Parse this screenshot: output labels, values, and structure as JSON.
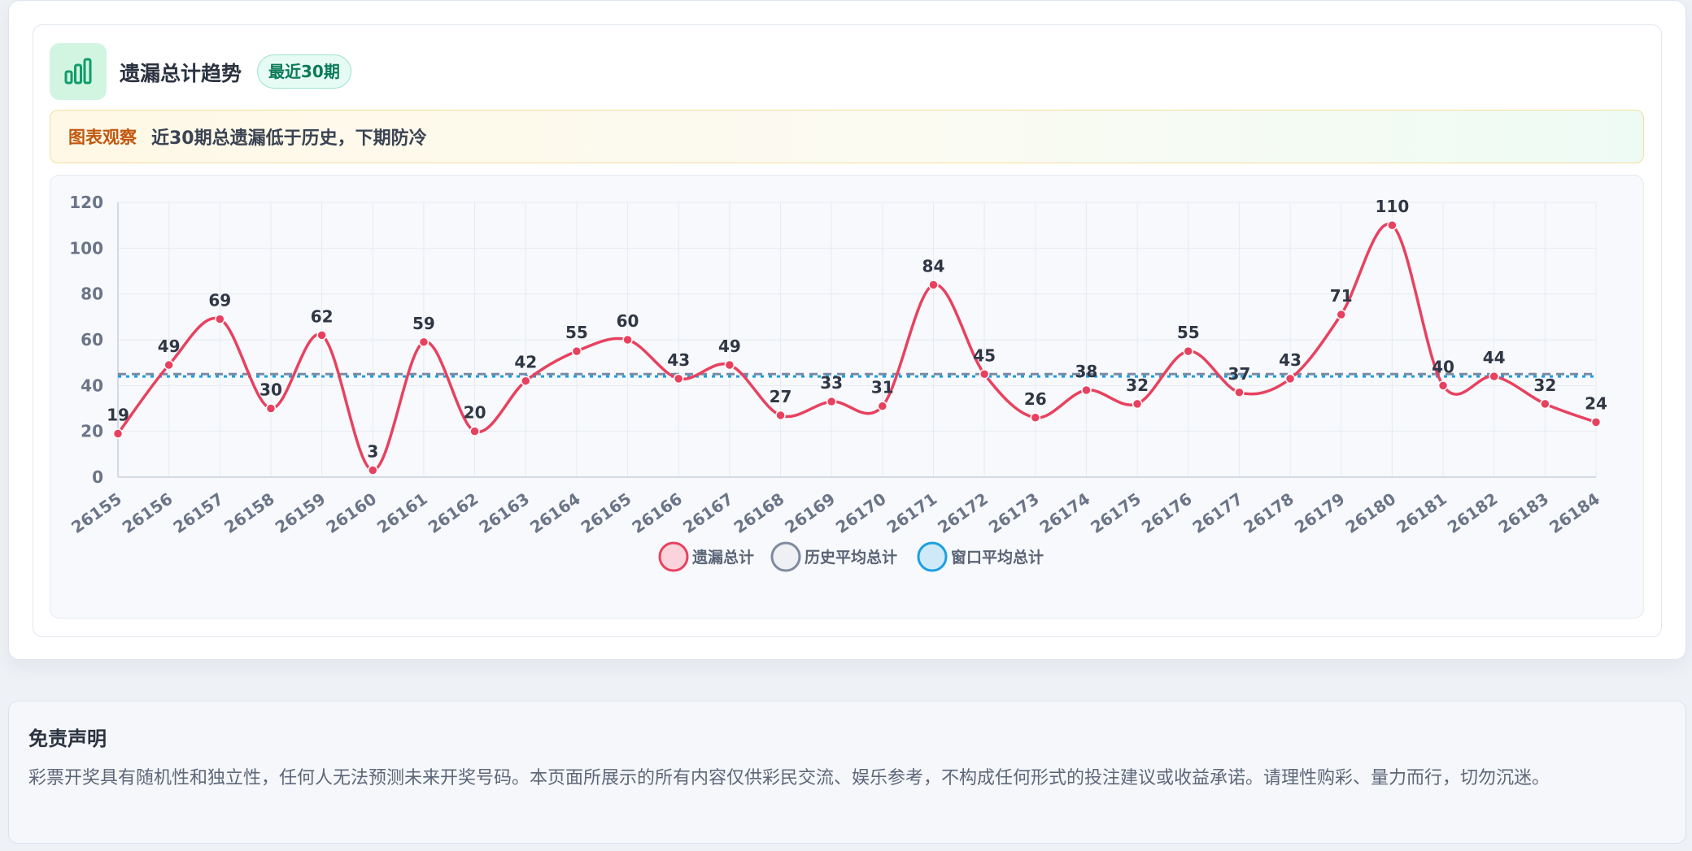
{
  "header": {
    "icon": "bar-chart-icon",
    "title": "遗漏总计趋势",
    "badge": "最近30期",
    "accent": "#0f9d6b"
  },
  "insight": {
    "label": "图表观察",
    "text": "近30期总遗漏低于历史，下期防冷"
  },
  "chart_data": {
    "type": "line",
    "title": "",
    "xlabel": "",
    "ylabel": "",
    "ylim": [
      0,
      120
    ],
    "yticks": [
      0,
      20,
      40,
      60,
      80,
      100,
      120
    ],
    "grid": true,
    "legend_position": "bottom-center",
    "categories": [
      "26155",
      "26156",
      "26157",
      "26158",
      "26159",
      "26160",
      "26161",
      "26162",
      "26163",
      "26164",
      "26165",
      "26166",
      "26167",
      "26168",
      "26169",
      "26170",
      "26171",
      "26172",
      "26173",
      "26174",
      "26175",
      "26176",
      "26177",
      "26178",
      "26179",
      "26180",
      "26181",
      "26182",
      "26183",
      "26184"
    ],
    "series": [
      {
        "name": "遗漏总计",
        "color": "#e8415f",
        "style": "solid-smooth-markers",
        "values": [
          19,
          49,
          69,
          30,
          62,
          3,
          59,
          20,
          42,
          55,
          60,
          43,
          49,
          27,
          33,
          31,
          84,
          45,
          26,
          38,
          32,
          55,
          37,
          43,
          71,
          110,
          40,
          44,
          32,
          24
        ]
      },
      {
        "name": "历史平均总计",
        "color": "#7d8aa0",
        "style": "dashed",
        "value": 45
      },
      {
        "name": "窗口平均总计",
        "color": "#1aa0e0",
        "style": "dotted",
        "value": 44
      }
    ]
  },
  "legend": [
    {
      "label": "遗漏总计",
      "fill": "#fbd3dc",
      "stroke": "#e8415f"
    },
    {
      "label": "历史平均总计",
      "fill": "#eef0f4",
      "stroke": "#7d8aa0"
    },
    {
      "label": "窗口平均总计",
      "fill": "#cfe9f8",
      "stroke": "#1aa0e0"
    }
  ],
  "disclaimer": {
    "title": "免责声明",
    "text": "彩票开奖具有随机性和独立性，任何人无法预测未来开奖号码。本页面所展示的所有内容仅供彩民交流、娱乐参考，不构成任何形式的投注建议或收益承诺。请理性购彩、量力而行，切勿沉迷。"
  }
}
